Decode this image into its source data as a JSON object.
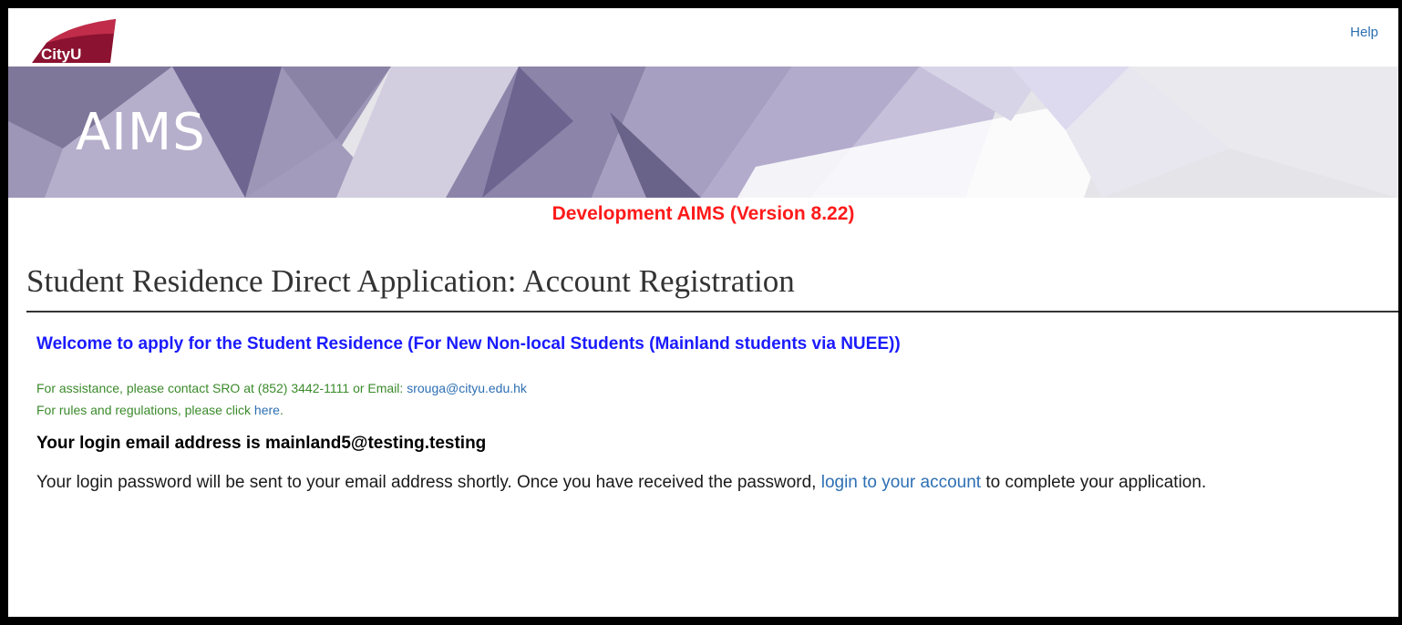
{
  "header": {
    "logo_text": "CityU",
    "help_label": "Help"
  },
  "banner": {
    "title": "AIMS"
  },
  "version_text": "Development AIMS (Version 8.22)",
  "page_title": "Student Residence Direct Application: Account Registration",
  "welcome_text": "Welcome to apply for the Student Residence (For New Non-local Students (Mainland students via NUEE))",
  "assistance": {
    "line1_prefix": "For assistance, please contact SRO at (852) 3442-1111 or Email: ",
    "email_link": "srouga@cityu.edu.hk",
    "line2_prefix": "For rules and regulations, please click ",
    "here_link": "here",
    "line2_suffix": "."
  },
  "login_email_text": "Your login email address is mainland5@testing.testing",
  "password_message": {
    "before_link": "Your login password will be sent to your email address shortly. Once you have received the password, ",
    "link_text": "login to your account",
    "after_link": " to complete your application."
  },
  "colors": {
    "version_red": "#ff1a1a",
    "welcome_blue": "#1a1aff",
    "assist_green": "#3a8a2a",
    "link_blue": "#2d6fb3",
    "logo_red": "#8b1230",
    "banner_purple": "#8a82a6"
  }
}
